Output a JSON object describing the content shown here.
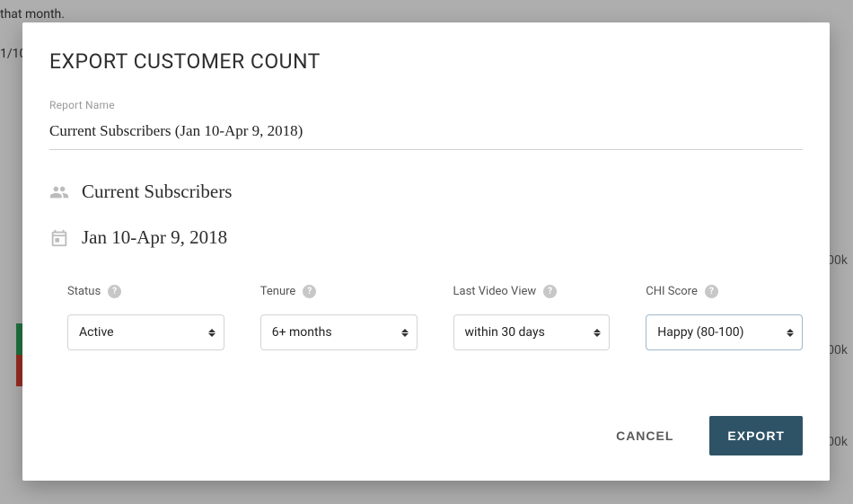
{
  "background": {
    "line1": "that month.",
    "line2": "1/10",
    "numA": "00k",
    "numB": "00k",
    "numC": "00k"
  },
  "modal": {
    "title": "EXPORT CUSTOMER COUNT",
    "report_name_label": "Report Name",
    "report_name_value": "Current Subscribers (Jan 10-Apr 9, 2018)",
    "subscribers_text": "Current Subscribers",
    "date_range_text": "Jan 10-Apr 9, 2018",
    "filters": {
      "status": {
        "label": "Status",
        "value": "Active"
      },
      "tenure": {
        "label": "Tenure",
        "value": "6+ months"
      },
      "lastview": {
        "label": "Last Video View",
        "value": "within 30 days"
      },
      "chi": {
        "label": "CHI Score",
        "value": "Happy (80-100)"
      }
    },
    "actions": {
      "cancel": "CANCEL",
      "export": "EXPORT"
    }
  }
}
